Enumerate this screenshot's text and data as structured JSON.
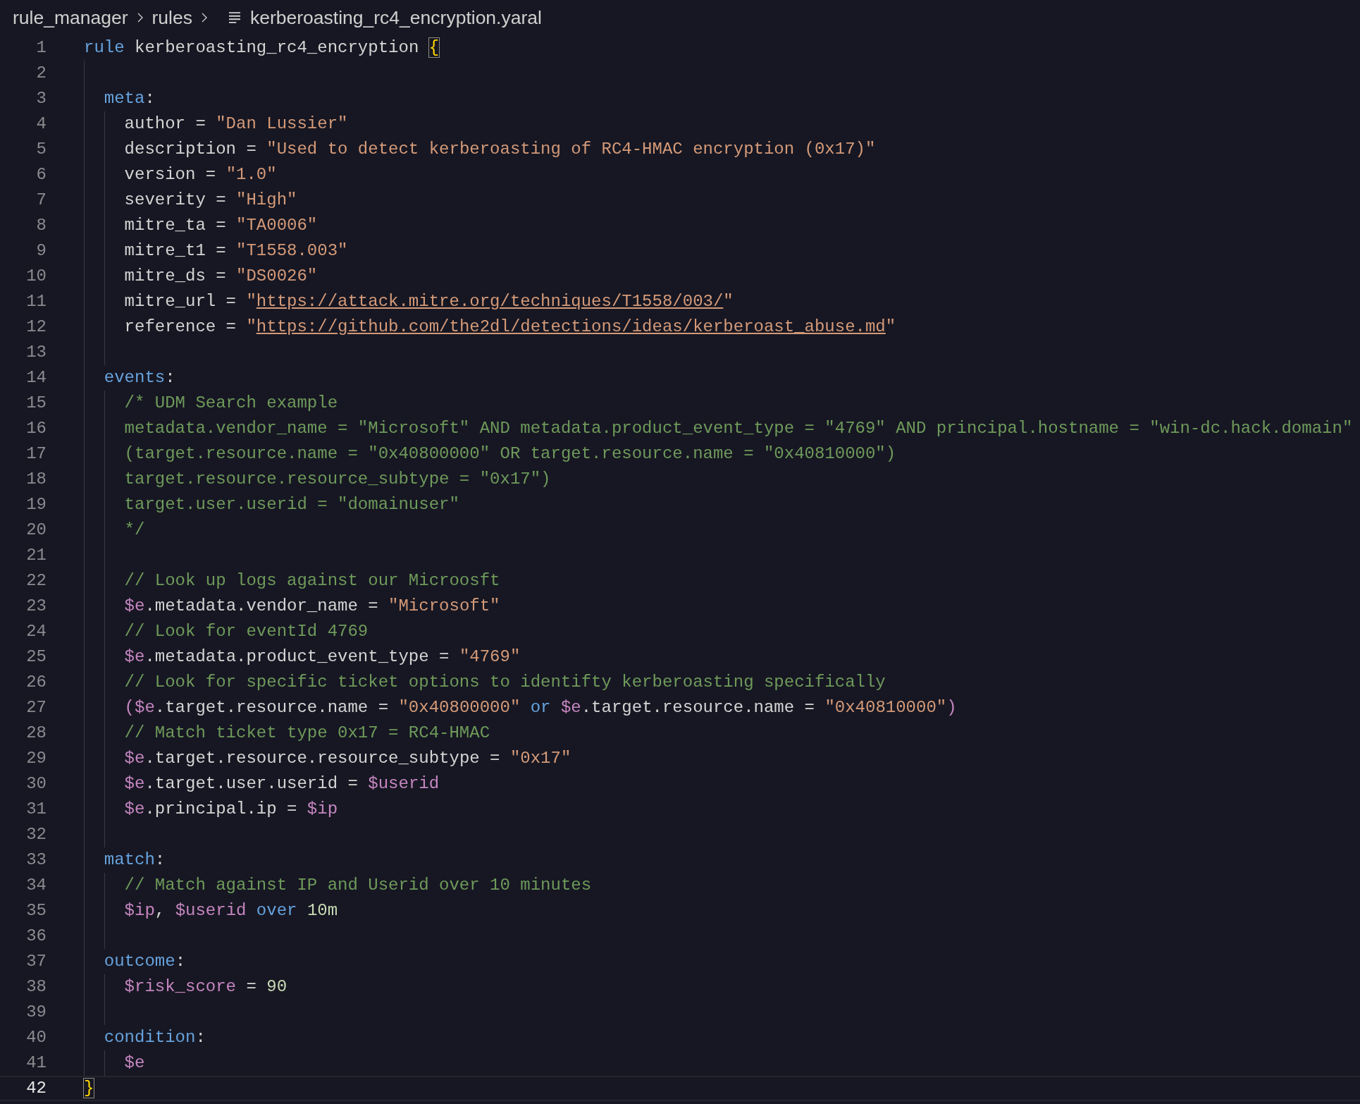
{
  "breadcrumb": [
    {
      "kind": "folder",
      "label": "rule_manager"
    },
    {
      "kind": "folder",
      "label": "rules"
    },
    {
      "kind": "file",
      "label": "kerberoasting_rc4_encryption.yaral"
    }
  ],
  "editor": {
    "lines": [
      {
        "number": "1",
        "current": false,
        "tokens": [
          {
            "kind": "keyword",
            "text": "rule"
          },
          {
            "kind": "plain",
            "text": " kerberoasting_rc4_encryption "
          },
          {
            "kind": "bracket",
            "text": "{"
          }
        ]
      },
      {
        "number": "2",
        "current": false
      },
      {
        "number": "3",
        "current": false,
        "tokens": [
          {
            "kind": "keyword",
            "text": "  meta"
          },
          {
            "kind": "plain",
            "text": ":"
          }
        ]
      },
      {
        "number": "4",
        "current": false,
        "tokens": [
          {
            "kind": "plain",
            "text": "    author = "
          },
          {
            "kind": "string",
            "text": "\"Dan Lussier\""
          }
        ]
      },
      {
        "number": "5",
        "current": false,
        "tokens": [
          {
            "kind": "plain",
            "text": "    description = "
          },
          {
            "kind": "string",
            "text": "\"Used to detect kerberoasting of RC4-HMAC encryption (0x17)\""
          }
        ]
      },
      {
        "number": "6",
        "current": false,
        "tokens": [
          {
            "kind": "plain",
            "text": "    version = "
          },
          {
            "kind": "string",
            "text": "\"1.0\""
          }
        ]
      },
      {
        "number": "7",
        "current": false,
        "tokens": [
          {
            "kind": "plain",
            "text": "    severity = "
          },
          {
            "kind": "string",
            "text": "\"High\""
          }
        ]
      },
      {
        "number": "8",
        "current": false,
        "tokens": [
          {
            "kind": "plain",
            "text": "    mitre_ta = "
          },
          {
            "kind": "string",
            "text": "\"TA0006\""
          }
        ]
      },
      {
        "number": "9",
        "current": false,
        "tokens": [
          {
            "kind": "plain",
            "text": "    mitre_t1 = "
          },
          {
            "kind": "string",
            "text": "\"T1558.003\""
          }
        ]
      },
      {
        "number": "10",
        "current": false,
        "tokens": [
          {
            "kind": "plain",
            "text": "    mitre_ds = "
          },
          {
            "kind": "string",
            "text": "\"DS0026\""
          }
        ]
      },
      {
        "number": "11",
        "current": false,
        "tokens": [
          {
            "kind": "plain",
            "text": "    mitre_url = "
          },
          {
            "kind": "string",
            "text": "\""
          },
          {
            "kind": "link",
            "text": "https://attack.mitre.org/techniques/T1558/003/"
          },
          {
            "kind": "string",
            "text": "\""
          }
        ]
      },
      {
        "number": "12",
        "current": false,
        "tokens": [
          {
            "kind": "plain",
            "text": "    reference = "
          },
          {
            "kind": "string",
            "text": "\""
          },
          {
            "kind": "link",
            "text": "https://github.com/the2dl/detections/ideas/kerberoast_abuse.md"
          },
          {
            "kind": "string",
            "text": "\""
          }
        ]
      },
      {
        "number": "13",
        "current": false
      },
      {
        "number": "14",
        "current": false,
        "tokens": [
          {
            "kind": "keyword",
            "text": "  events"
          },
          {
            "kind": "plain",
            "text": ":"
          }
        ]
      },
      {
        "number": "15",
        "current": false,
        "tokens": [
          {
            "kind": "comment",
            "text": "    /* UDM Search example"
          }
        ]
      },
      {
        "number": "16",
        "current": false,
        "tokens": [
          {
            "kind": "comment",
            "text": "    metadata.vendor_name = \"Microsoft\" AND metadata.product_event_type = \"4769\" AND principal.hostname = \"win-dc.hack.domain\""
          }
        ]
      },
      {
        "number": "17",
        "current": false,
        "tokens": [
          {
            "kind": "comment",
            "text": "    (target.resource.name = \"0x40800000\" OR target.resource.name = \"0x40810000\")"
          }
        ]
      },
      {
        "number": "18",
        "current": false,
        "tokens": [
          {
            "kind": "comment",
            "text": "    target.resource.resource_subtype = \"0x17\")"
          }
        ]
      },
      {
        "number": "19",
        "current": false,
        "tokens": [
          {
            "kind": "comment",
            "text": "    target.user.userid = \"domainuser\""
          }
        ]
      },
      {
        "number": "20",
        "current": false,
        "tokens": [
          {
            "kind": "comment",
            "text": "    */"
          }
        ]
      },
      {
        "number": "21",
        "current": false
      },
      {
        "number": "22",
        "current": false,
        "tokens": [
          {
            "kind": "comment",
            "text": "    // Look up logs against our Microosft"
          }
        ]
      },
      {
        "number": "23",
        "current": false,
        "tokens": [
          {
            "kind": "variable",
            "text": "    $e"
          },
          {
            "kind": "plain",
            "text": ".metadata.vendor_name = "
          },
          {
            "kind": "string",
            "text": "\"Microsoft\""
          }
        ]
      },
      {
        "number": "24",
        "current": false,
        "tokens": [
          {
            "kind": "comment",
            "text": "    // Look for eventId 4769"
          }
        ]
      },
      {
        "number": "25",
        "current": false,
        "tokens": [
          {
            "kind": "variable",
            "text": "    $e"
          },
          {
            "kind": "plain",
            "text": ".metadata.product_event_type = "
          },
          {
            "kind": "string",
            "text": "\"4769\""
          }
        ]
      },
      {
        "number": "26",
        "current": false,
        "tokens": [
          {
            "kind": "comment",
            "text": "    // Look for specific ticket options to identifty kerberoasting specifically"
          }
        ]
      },
      {
        "number": "27",
        "current": false,
        "tokens": [
          {
            "kind": "variable",
            "text": "    ($e"
          },
          {
            "kind": "plain",
            "text": ".target.resource.name = "
          },
          {
            "kind": "string",
            "text": "\"0x40800000\""
          },
          {
            "kind": "keyword",
            "text": " or "
          },
          {
            "kind": "variable",
            "text": "$e"
          },
          {
            "kind": "plain",
            "text": ".target.resource.name = "
          },
          {
            "kind": "string",
            "text": "\"0x40810000\""
          },
          {
            "kind": "variable",
            "text": ")"
          }
        ]
      },
      {
        "number": "28",
        "current": false,
        "tokens": [
          {
            "kind": "comment",
            "text": "    // Match ticket type 0x17 = RC4-HMAC"
          }
        ]
      },
      {
        "number": "29",
        "current": false,
        "tokens": [
          {
            "kind": "variable",
            "text": "    $e"
          },
          {
            "kind": "plain",
            "text": ".target.resource.resource_subtype = "
          },
          {
            "kind": "string",
            "text": "\"0x17\""
          }
        ]
      },
      {
        "number": "30",
        "current": false,
        "tokens": [
          {
            "kind": "variable",
            "text": "    $e"
          },
          {
            "kind": "plain",
            "text": ".target.user.userid = "
          },
          {
            "kind": "variable",
            "text": "$userid"
          }
        ]
      },
      {
        "number": "31",
        "current": false,
        "tokens": [
          {
            "kind": "variable",
            "text": "    $e"
          },
          {
            "kind": "plain",
            "text": ".principal.ip = "
          },
          {
            "kind": "variable",
            "text": "$ip"
          }
        ]
      },
      {
        "number": "32",
        "current": false
      },
      {
        "number": "33",
        "current": false,
        "tokens": [
          {
            "kind": "keyword",
            "text": "  match"
          },
          {
            "kind": "plain",
            "text": ":"
          }
        ]
      },
      {
        "number": "34",
        "current": false,
        "tokens": [
          {
            "kind": "comment",
            "text": "    // Match against IP and Userid over 10 minutes"
          }
        ]
      },
      {
        "number": "35",
        "current": false,
        "tokens": [
          {
            "kind": "variable",
            "text": "    $ip"
          },
          {
            "kind": "plain",
            "text": ", "
          },
          {
            "kind": "variable",
            "text": "$userid"
          },
          {
            "kind": "keyword",
            "text": " over "
          },
          {
            "kind": "number",
            "text": "10m"
          }
        ]
      },
      {
        "number": "36",
        "current": false
      },
      {
        "number": "37",
        "current": false,
        "tokens": [
          {
            "kind": "keyword",
            "text": "  outcome"
          },
          {
            "kind": "plain",
            "text": ":"
          }
        ]
      },
      {
        "number": "38",
        "current": false,
        "tokens": [
          {
            "kind": "variable",
            "text": "    $risk_score"
          },
          {
            "kind": "plain",
            "text": " = "
          },
          {
            "kind": "number",
            "text": "90"
          }
        ]
      },
      {
        "number": "39",
        "current": false
      },
      {
        "number": "40",
        "current": false,
        "tokens": [
          {
            "kind": "keyword",
            "text": "  condition"
          },
          {
            "kind": "plain",
            "text": ":"
          }
        ]
      },
      {
        "number": "41",
        "current": false,
        "tokens": [
          {
            "kind": "variable",
            "text": "    $e"
          }
        ]
      },
      {
        "number": "42",
        "current": true,
        "tokens": [
          {
            "kind": "bracket",
            "text": "}"
          }
        ]
      }
    ]
  }
}
